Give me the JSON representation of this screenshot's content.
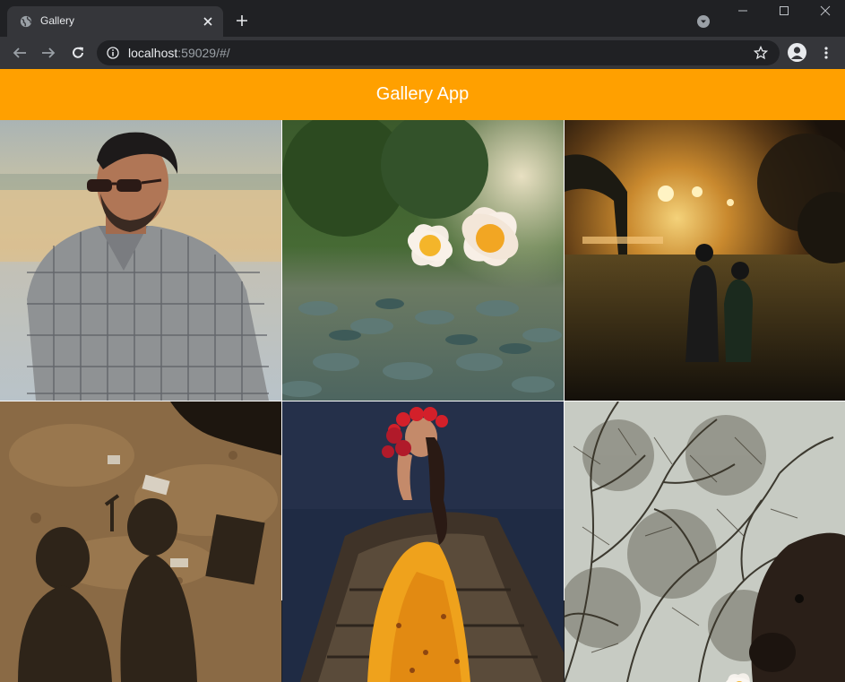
{
  "browser": {
    "tab": {
      "title": "Gallery",
      "favicon": "globe-icon"
    },
    "address": {
      "host": "localhost",
      "rest": ":59029/#/"
    }
  },
  "app": {
    "title": "Gallery App"
  },
  "gallery": {
    "photos": [
      {
        "subject": "man-in-sunglasses"
      },
      {
        "subject": "frangipani-flowers"
      },
      {
        "subject": "couple-at-night"
      },
      {
        "subject": "shadows-on-ground"
      },
      {
        "subject": "woman-in-boat"
      },
      {
        "subject": "trees-and-flower"
      }
    ]
  },
  "colors": {
    "appbar": "#ffa000",
    "chrome_dark": "#202124",
    "chrome_mid": "#35363a"
  }
}
